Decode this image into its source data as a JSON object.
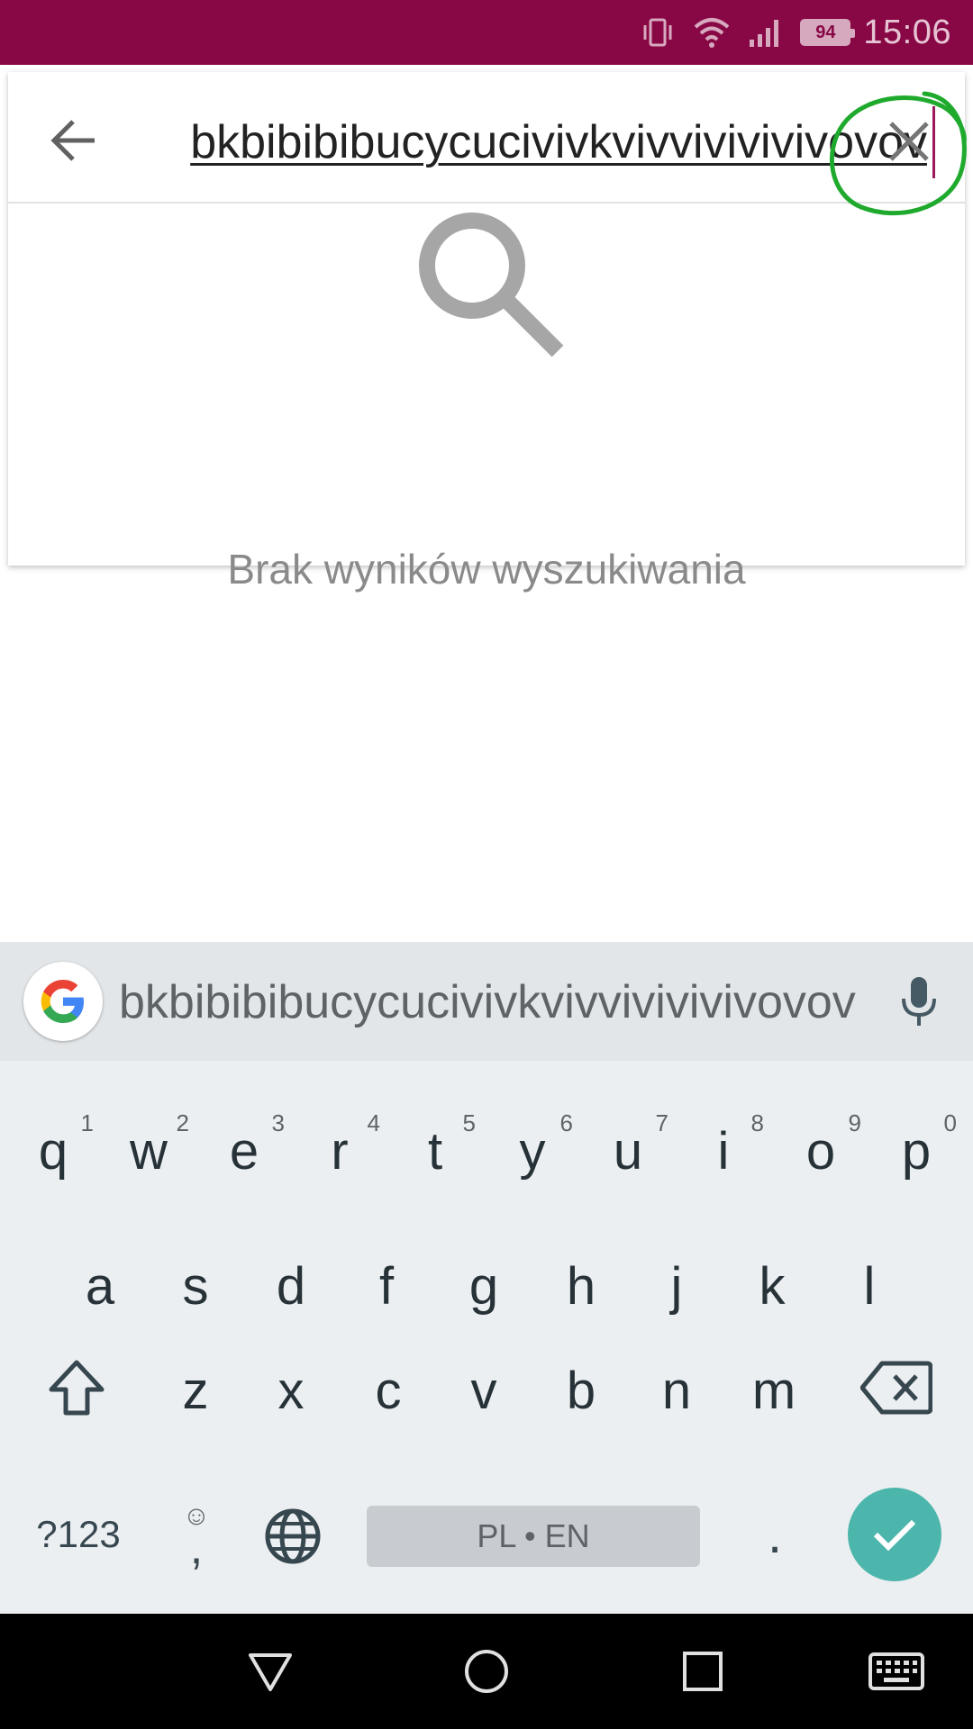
{
  "status_bar": {
    "battery": "94",
    "time": "15:06",
    "icons": [
      "vibrate-icon",
      "wifi-icon",
      "signal-icon",
      "battery-icon"
    ]
  },
  "search": {
    "query": "bkbibibibucycucivivkvivvivivivivovov",
    "back_icon": "back-arrow-icon",
    "clear_icon": "close-icon"
  },
  "empty_state": {
    "icon": "search-icon",
    "message": "Brak wyników wyszukiwania"
  },
  "keyboard": {
    "suggestion": "bkbibibibucycucivivkvivvivivivivovov",
    "row1": [
      {
        "key": "q",
        "hint": "1"
      },
      {
        "key": "w",
        "hint": "2"
      },
      {
        "key": "e",
        "hint": "3"
      },
      {
        "key": "r",
        "hint": "4"
      },
      {
        "key": "t",
        "hint": "5"
      },
      {
        "key": "y",
        "hint": "6"
      },
      {
        "key": "u",
        "hint": "7"
      },
      {
        "key": "i",
        "hint": "8"
      },
      {
        "key": "o",
        "hint": "9"
      },
      {
        "key": "p",
        "hint": "0"
      }
    ],
    "row2": [
      "a",
      "s",
      "d",
      "f",
      "g",
      "h",
      "j",
      "k",
      "l"
    ],
    "row3": [
      "z",
      "x",
      "c",
      "v",
      "b",
      "n",
      "m"
    ],
    "symbols_label": "?123",
    "comma_label": ",",
    "space_label": "PL • EN",
    "period_label": ".",
    "accent_color": "#4db6ac"
  },
  "colors": {
    "status_bar": "#880846",
    "keyboard_bg": "#eceff1",
    "annotation": "#1faa2e"
  }
}
